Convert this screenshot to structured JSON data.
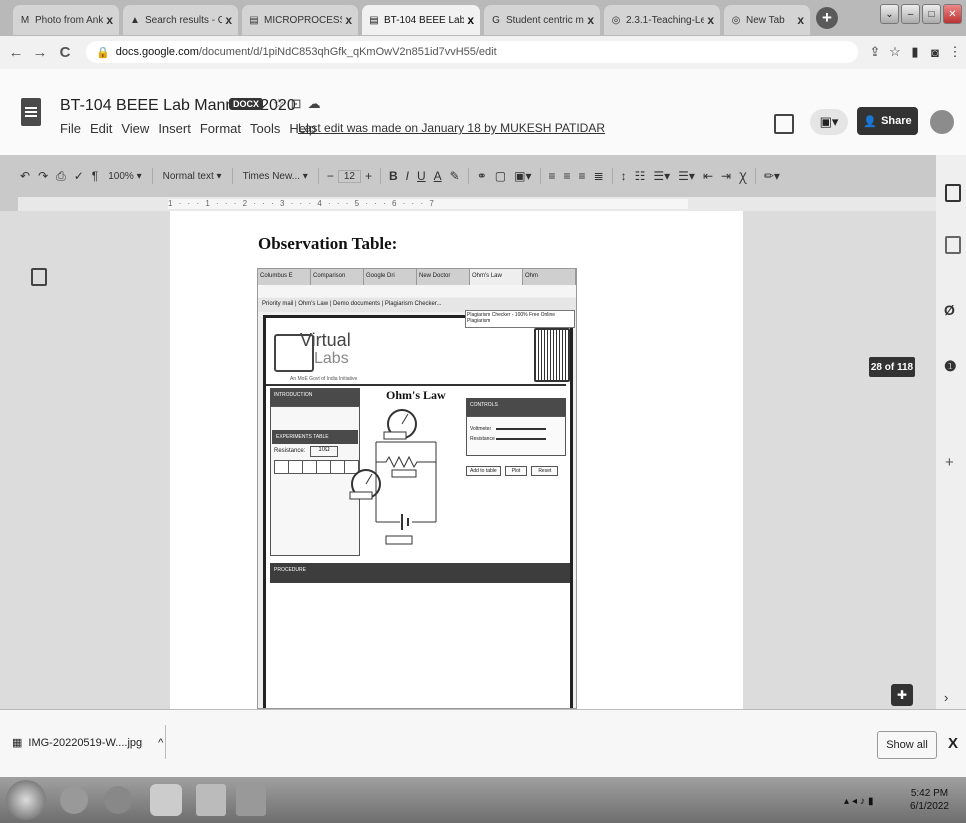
{
  "tabs": [
    {
      "label": "Photo from Ankit",
      "icon": "gmail-icon",
      "close": "x"
    },
    {
      "label": "Search results - G",
      "icon": "drive-icon",
      "close": "x"
    },
    {
      "label": "MICROPROCESSO",
      "icon": "docs-icon",
      "close": "x"
    },
    {
      "label": "BT-104 BEEE Lab",
      "icon": "docs-icon",
      "close": "x"
    },
    {
      "label": "Student centric m",
      "icon": "google-icon",
      "close": "x"
    },
    {
      "label": "2.3.1-Teaching-Le",
      "icon": "chrome-icon",
      "close": "x"
    },
    {
      "label": "New Tab",
      "icon": "chrome-icon",
      "close": "x"
    }
  ],
  "address_bar": {
    "host": "docs.google.com",
    "path": "/document/d/1piNdC853qhGfk_qKmOwV2n851id7vvH55/edit"
  },
  "doc": {
    "title": "BT-104 BEEE Lab Mannual 2020",
    "badge": "DOCX",
    "menu": [
      "File",
      "Edit",
      "View",
      "Insert",
      "Format",
      "Tools",
      "Help"
    ],
    "last_edit": "Last edit was made on January 18 by MUKESH PATIDAR",
    "share_label": "Share",
    "heading": "Observation Table:",
    "page_counter": "28 of 118"
  },
  "toolbar": {
    "zoom": "100%",
    "style": "Normal text",
    "font": "Times New...",
    "font_size": "12"
  },
  "ruler": {
    "text": "1 · · · 1 · · · 2 · · · 3 · · · 4 · · · 5 · · · 6 · · · 7"
  },
  "embedded": {
    "tabs": [
      "Columbus E",
      "Comparison",
      "Google Dri",
      "New Doctor",
      "Ohm's Law",
      "Ohm"
    ],
    "bookmarks": "Priority mail | Ohm's Law | Demo documents | Plagiarism Checker...",
    "tooltip": "Plagiarism Checker - 100% Free Online Plagiarism",
    "logo_text_1": "Virtual",
    "logo_text_2": "Labs",
    "logo_subtext": "An MoE Govt of India Initiative",
    "left_header": "INTRODUCTION",
    "exp_header": "EXPERIMENTS TABLE",
    "resistance_label": "Resistance:",
    "resistance_value": "10Ω",
    "title": "Ohm's Law",
    "controls_header": "CONTROLS",
    "slider1": "Voltmeter",
    "slider2": "Resistance",
    "buttons": [
      "Add to table",
      "Plot",
      "Reset"
    ],
    "footer_header": "PROCEDURE"
  },
  "downloads": {
    "file": "IMG-20220519-W....jpg",
    "show_all": "Show all",
    "close": "X"
  },
  "taskbar": {
    "time": "5:42 PM",
    "date": "6/1/2022"
  }
}
